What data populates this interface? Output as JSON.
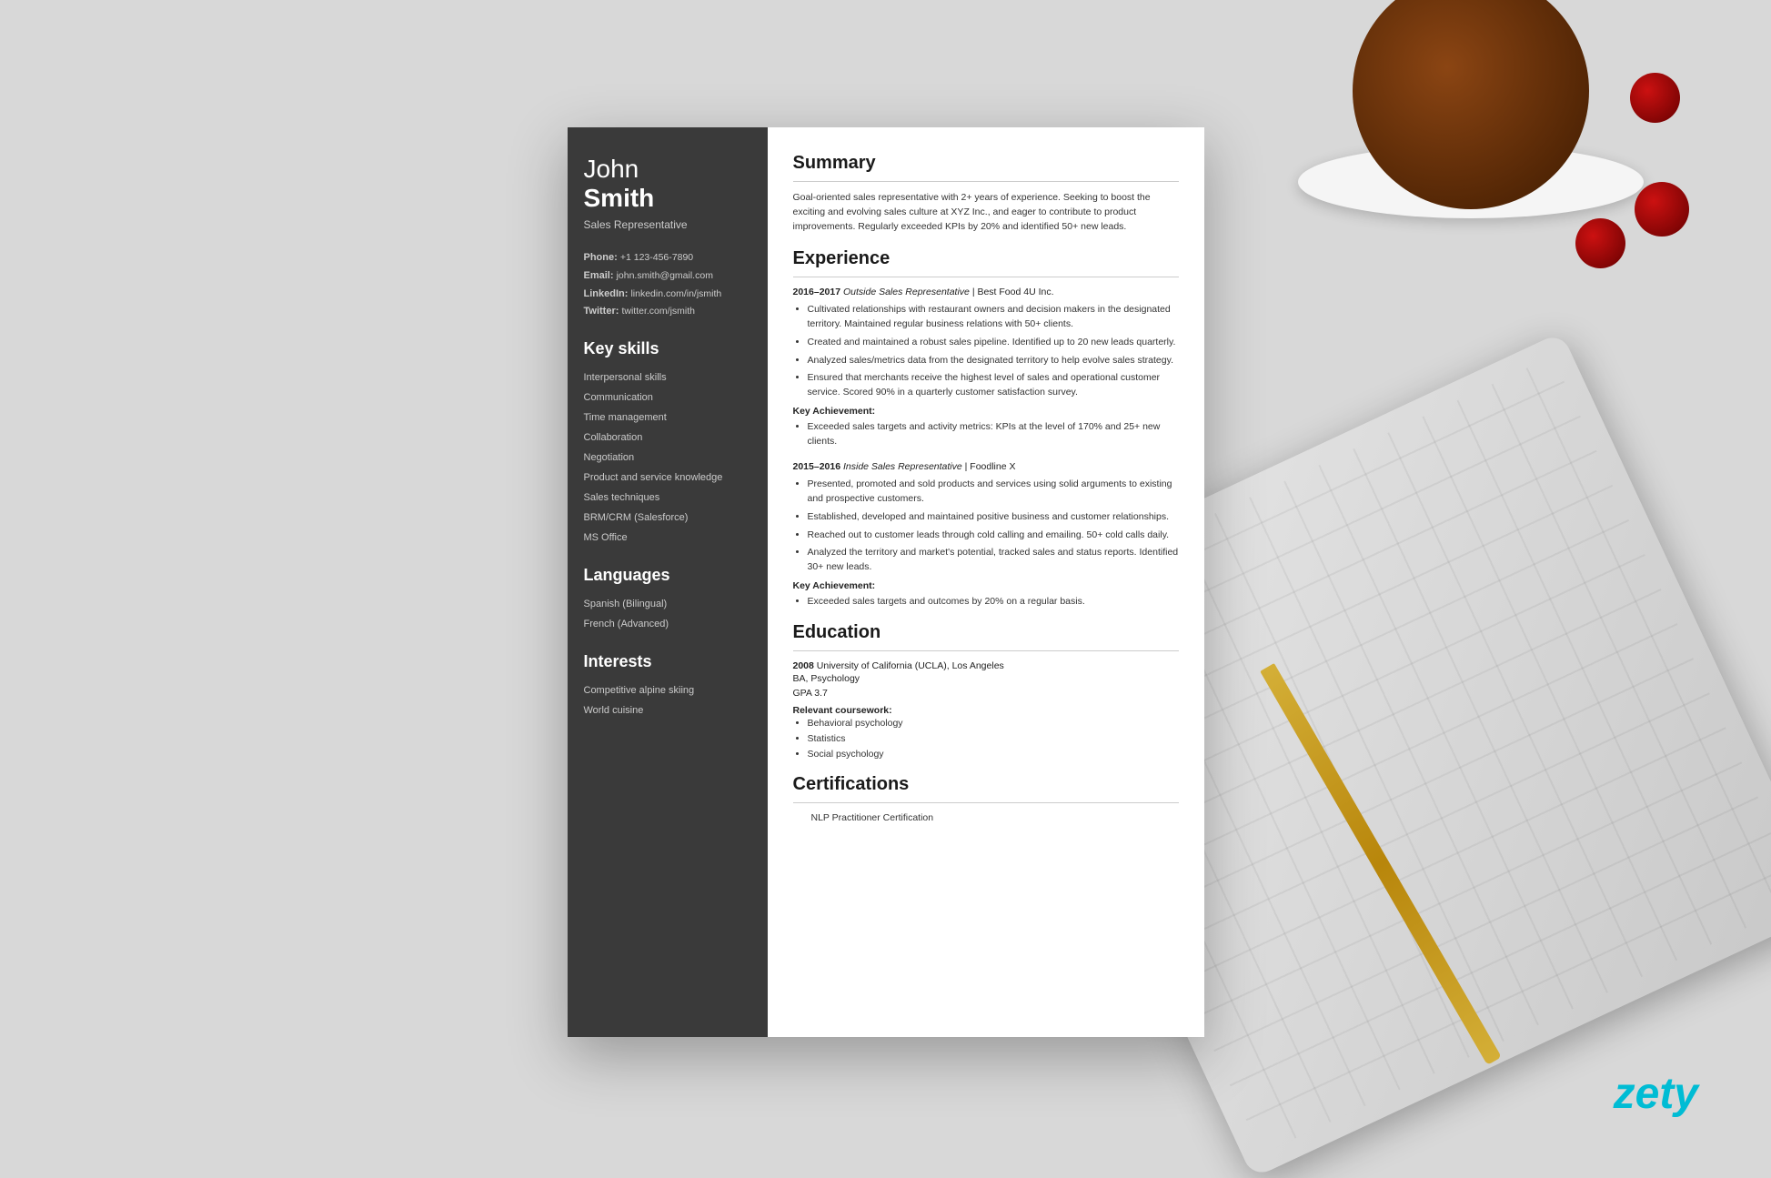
{
  "page": {
    "background_color": "#d8d8d8"
  },
  "branding": {
    "logo": "zety"
  },
  "resume": {
    "sidebar": {
      "name": {
        "first": "John",
        "last": "Smith"
      },
      "title": "Sales Representative",
      "contact": {
        "phone_label": "Phone:",
        "phone_value": "+1 123-456-7890",
        "email_label": "Email:",
        "email_value": "john.smith@gmail.com",
        "linkedin_label": "LinkedIn:",
        "linkedin_value": "linkedin.com/in/jsmith",
        "twitter_label": "Twitter:",
        "twitter_value": "twitter.com/jsmith"
      },
      "skills_section": "Key skills",
      "skills": [
        "Interpersonal skills",
        "Communication",
        "Time management",
        "Collaboration",
        "Negotiation",
        "Product and service knowledge",
        "Sales techniques",
        "BRM/CRM (Salesforce)",
        "MS Office"
      ],
      "languages_section": "Languages",
      "languages": [
        "Spanish (Bilingual)",
        "French (Advanced)"
      ],
      "interests_section": "Interests",
      "interests": [
        "Competitive alpine skiing",
        "World cuisine"
      ]
    },
    "main": {
      "summary_title": "Summary",
      "summary_text": "Goal-oriented sales representative with 2+ years of experience. Seeking to boost the exciting and evolving sales culture at XYZ Inc., and eager to contribute to product improvements. Regularly exceeded KPIs by 20% and identified 50+ new leads.",
      "experience_title": "Experience",
      "experience": [
        {
          "years": "2016–2017",
          "role": "Outside Sales Representative",
          "company": "Best Food 4U Inc.",
          "bullets": [
            "Cultivated relationships with restaurant owners and decision makers in the designated territory. Maintained regular business relations with 50+ clients.",
            "Created and maintained a robust sales pipeline. Identified up to 20 new leads quarterly.",
            "Analyzed sales/metrics data from the designated territory to help evolve sales strategy.",
            "Ensured that merchants receive the highest level of sales and operational customer service. Scored 90% in a quarterly customer satisfaction survey."
          ],
          "achievement_label": "Key Achievement:",
          "achievement": "Exceeded sales targets and activity metrics: KPIs at the level of 170% and 25+ new clients."
        },
        {
          "years": "2015–2016",
          "role": "Inside Sales Representative",
          "company": "Foodline X",
          "bullets": [
            "Presented, promoted and sold products and services using solid arguments to existing and prospective customers.",
            "Established, developed and maintained positive business and customer relationships.",
            "Reached out to customer leads through cold calling and emailing. 50+ cold calls daily.",
            "Analyzed the territory and market's potential, tracked sales and status reports. Identified 30+ new leads."
          ],
          "achievement_label": "Key Achievement:",
          "achievement": "Exceeded sales targets and outcomes by 20% on a regular basis."
        }
      ],
      "education_title": "Education",
      "education": [
        {
          "year": "2008",
          "school": "University of California (UCLA), Los Angeles",
          "degree": "BA, Psychology",
          "gpa": "GPA 3.7",
          "coursework_label": "Relevant coursework:",
          "coursework": [
            "Behavioral psychology",
            "Statistics",
            "Social psychology"
          ]
        }
      ],
      "certifications_title": "Certifications",
      "certifications": [
        "NLP Practitioner Certification"
      ]
    }
  }
}
